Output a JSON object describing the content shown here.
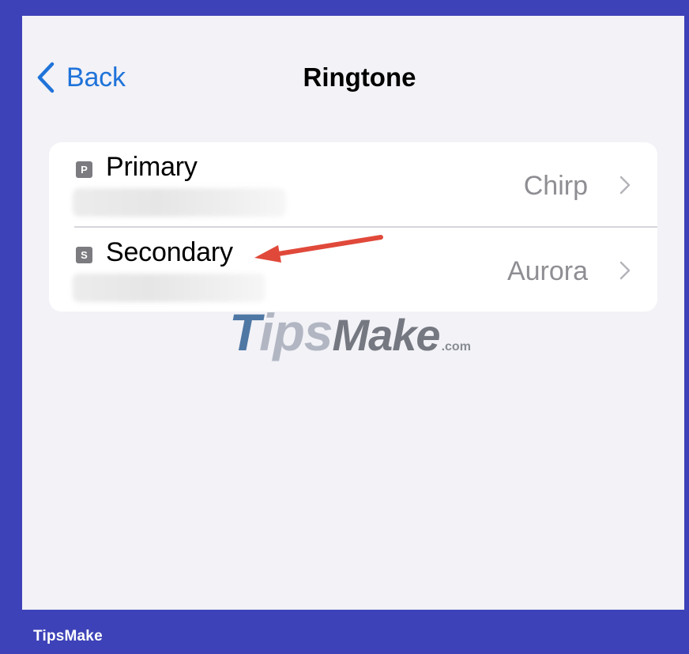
{
  "nav": {
    "back_label": "Back",
    "title": "Ringtone"
  },
  "lines": [
    {
      "badge": "P",
      "name": "Primary",
      "ringtone": "Chirp"
    },
    {
      "badge": "S",
      "name": "Secondary",
      "ringtone": "Aurora"
    }
  ],
  "annotation": {
    "arrow_color": "#e0493a",
    "points_to": "Secondary"
  },
  "watermark": {
    "text_a": "T",
    "text_b": "ips",
    "text_c": "M",
    "text_d": "ake",
    "suffix": ".com"
  },
  "footer": {
    "brand": "TipsMake"
  },
  "colors": {
    "frame": "#3d42b8",
    "background": "#f2f2f7",
    "accent": "#1f73d9",
    "secondary_text": "#8e8e93"
  },
  "icons": {
    "back": "chevron-left-icon",
    "disclosure": "chevron-right-icon"
  }
}
